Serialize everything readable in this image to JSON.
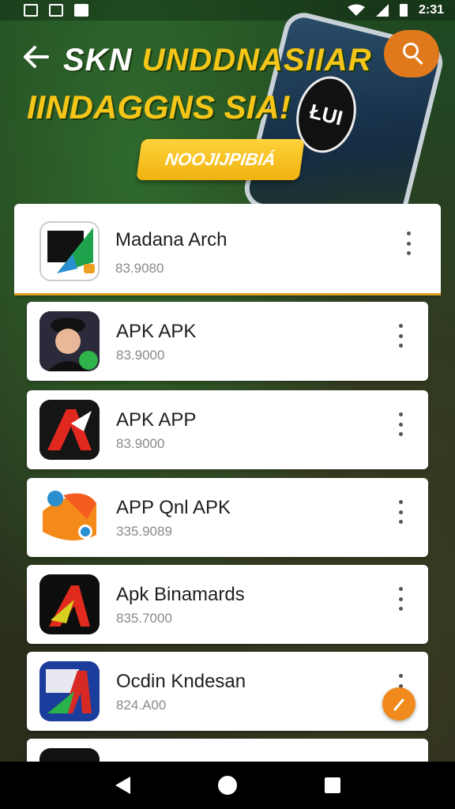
{
  "status_bar": {
    "time": "2:31",
    "icons": [
      "download-icon",
      "image-icon",
      "message-icon",
      "wifi-icon",
      "signal-icon",
      "battery-icon"
    ]
  },
  "banner": {
    "line1_a": "SKN",
    "line1_b": "UNDDNASIIAR",
    "line2": "IINDAGGNS SIA!",
    "cta_label": "NOOJIJPIBIÁ",
    "phone_logo": "ŁUI",
    "accent_color": "#f5c518",
    "search_fab_color": "#e0781c"
  },
  "apps": [
    {
      "name": "Madana Arch",
      "subtitle": "83.9080",
      "icon": "app-icon-madana"
    },
    {
      "name": "APK  APK",
      "subtitle": "83.9000",
      "icon": "app-icon-avatar"
    },
    {
      "name": "APK APP",
      "subtitle": "83.9000",
      "icon": "app-icon-red-a"
    },
    {
      "name": "APP Qnl APK",
      "subtitle": "335.9089",
      "icon": "app-icon-orange"
    },
    {
      "name": "Apk Binamards",
      "subtitle": "835.7000",
      "icon": "app-icon-yellow-a"
    },
    {
      "name": "Ocdin Kndesan",
      "subtitle": "824.A00",
      "icon": "app-icon-blue"
    }
  ],
  "fab_color": "#f08a1c"
}
